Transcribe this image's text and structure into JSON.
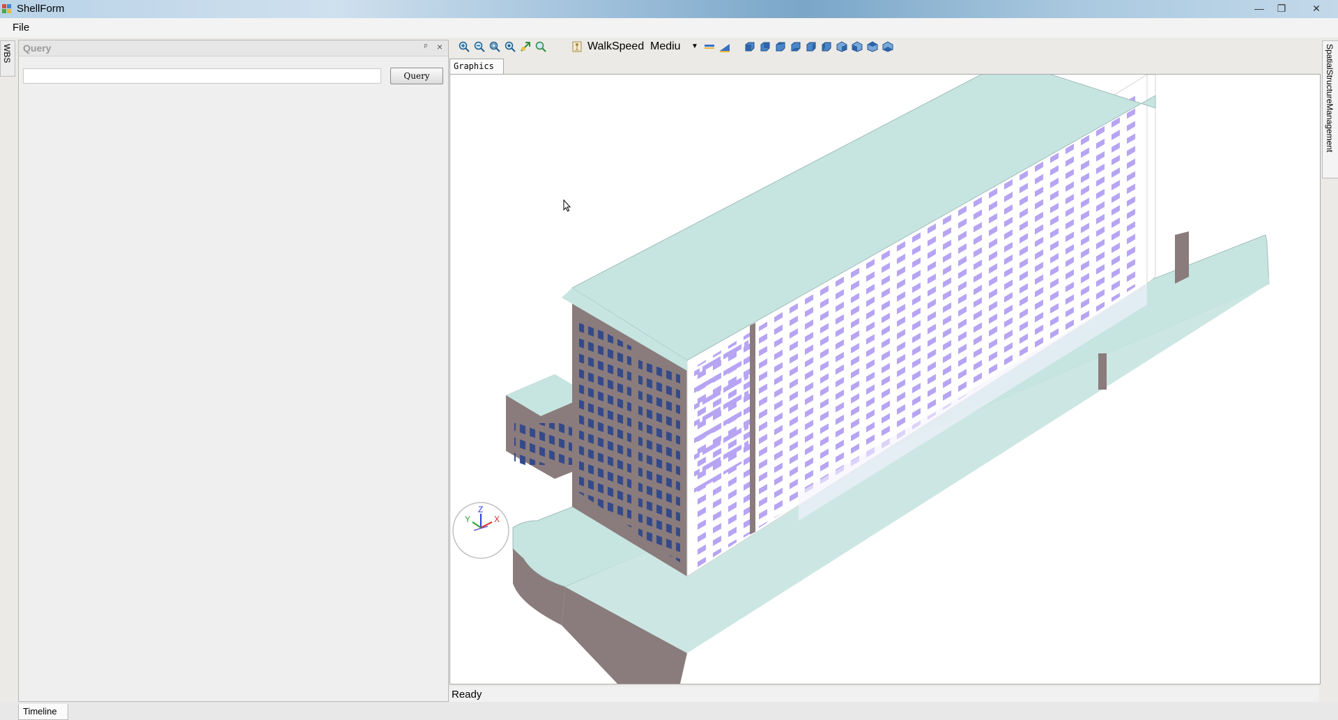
{
  "window": {
    "title": "ShellForm",
    "minimize": "—",
    "restore": "❐",
    "close": "✕"
  },
  "menu": {
    "file": "File"
  },
  "left_dock": {
    "wbs": "WBS"
  },
  "query_panel": {
    "title": "Query",
    "pin": "ᵖ",
    "close": "×",
    "input_value": "",
    "button": "Query"
  },
  "toolbar": {
    "walkspeed_label": "WalkSpeed",
    "speed_value": "Mediu",
    "icons": [
      "zoom-in-icon",
      "zoom-out-icon",
      "zoom-window-icon",
      "zoom-extents-icon",
      "pan-icon",
      "zoom-all-icon",
      "walk-icon",
      "measure-icon",
      "section-icon",
      "view-front-icon",
      "view-back-icon",
      "view-top-icon",
      "view-bottom-icon",
      "view-left-icon",
      "view-right-icon",
      "view-iso1-icon",
      "view-iso2-icon",
      "view-iso3-icon",
      "view-iso4-icon"
    ]
  },
  "graphics_tab": {
    "label": "Graphics"
  },
  "axes": {
    "x": "X",
    "y": "Y",
    "z": "Z"
  },
  "status": {
    "text": "Ready"
  },
  "right_dock": {
    "ssm": "SpatialStructureManagement"
  },
  "bottom": {
    "timeline": "Timeline"
  },
  "colors": {
    "roof": "#c6e4e0",
    "facade": "#ffffff",
    "window": "#b7a4f3",
    "dark_side": "#8a7c7c",
    "dark_window": "#33498a"
  }
}
